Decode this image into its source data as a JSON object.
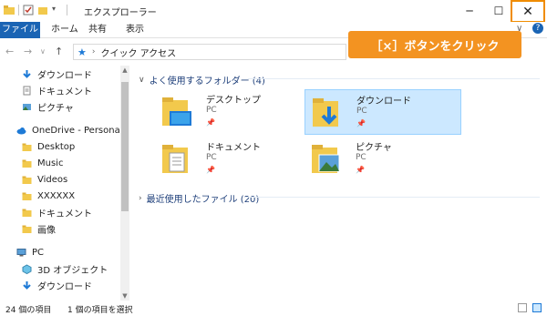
{
  "titlebar": {
    "title": "エクスプローラー",
    "minimize_label": "─",
    "maximize_label": "☐",
    "close_label": "✕"
  },
  "ribbon": {
    "tabs": [
      "ファイル",
      "ホーム",
      "共有",
      "表示"
    ],
    "expand_label": "∨",
    "help_label": "?"
  },
  "callout": {
    "text": "［×］ボタンをクリック"
  },
  "navigation": {
    "back": "←",
    "forward": "→",
    "recent": "∨",
    "up": "↑",
    "breadcrumb_sep": "›",
    "address": "クイック アクセス"
  },
  "sidebar": {
    "items": [
      {
        "label": "ダウンロード",
        "icon": "download-icon",
        "pinned": true
      },
      {
        "label": "ドキュメント",
        "icon": "document-icon",
        "pinned": true
      },
      {
        "label": "ピクチャ",
        "icon": "picture-icon",
        "pinned": true
      },
      {
        "label": "OneDrive - Personal",
        "icon": "cloud-icon",
        "pinned": false
      },
      {
        "label": "Desktop",
        "icon": "folder-icon",
        "pinned": false
      },
      {
        "label": "Music",
        "icon": "folder-icon",
        "pinned": false
      },
      {
        "label": "Videos",
        "icon": "folder-icon",
        "pinned": false
      },
      {
        "label": "XXXXXX",
        "icon": "folder-icon",
        "pinned": false
      },
      {
        "label": "ドキュメント",
        "icon": "folder-icon",
        "pinned": false
      },
      {
        "label": "画像",
        "icon": "folder-icon",
        "pinned": false
      },
      {
        "label": "PC",
        "icon": "pc-icon",
        "pinned": false
      },
      {
        "label": "3D オブジェクト",
        "icon": "3d-objects-icon",
        "pinned": false
      },
      {
        "label": "ダウンロード",
        "icon": "download-icon",
        "pinned": false
      }
    ],
    "pin_glyph": "📌"
  },
  "main": {
    "frequent_header": "よく使用するフォルダー (4)",
    "recent_header": "最近使用したファイル (20)",
    "folders": [
      {
        "name": "デスクトップ",
        "location": "PC",
        "icon": "desktop-folder-icon",
        "selected": false
      },
      {
        "name": "ダウンロード",
        "location": "PC",
        "icon": "downloads-folder-icon",
        "selected": true
      },
      {
        "name": "ドキュメント",
        "location": "PC",
        "icon": "documents-folder-icon",
        "selected": false
      },
      {
        "name": "ピクチャ",
        "location": "PC",
        "icon": "pictures-folder-icon",
        "selected": false
      }
    ]
  },
  "statusbar": {
    "item_count": "24 個の項目",
    "selection": "1 個の項目を選択"
  },
  "colors": {
    "accent": "#1a64b4",
    "callout": "#f39321",
    "close_highlight": "#f08c00",
    "selection": "#cce8ff"
  }
}
